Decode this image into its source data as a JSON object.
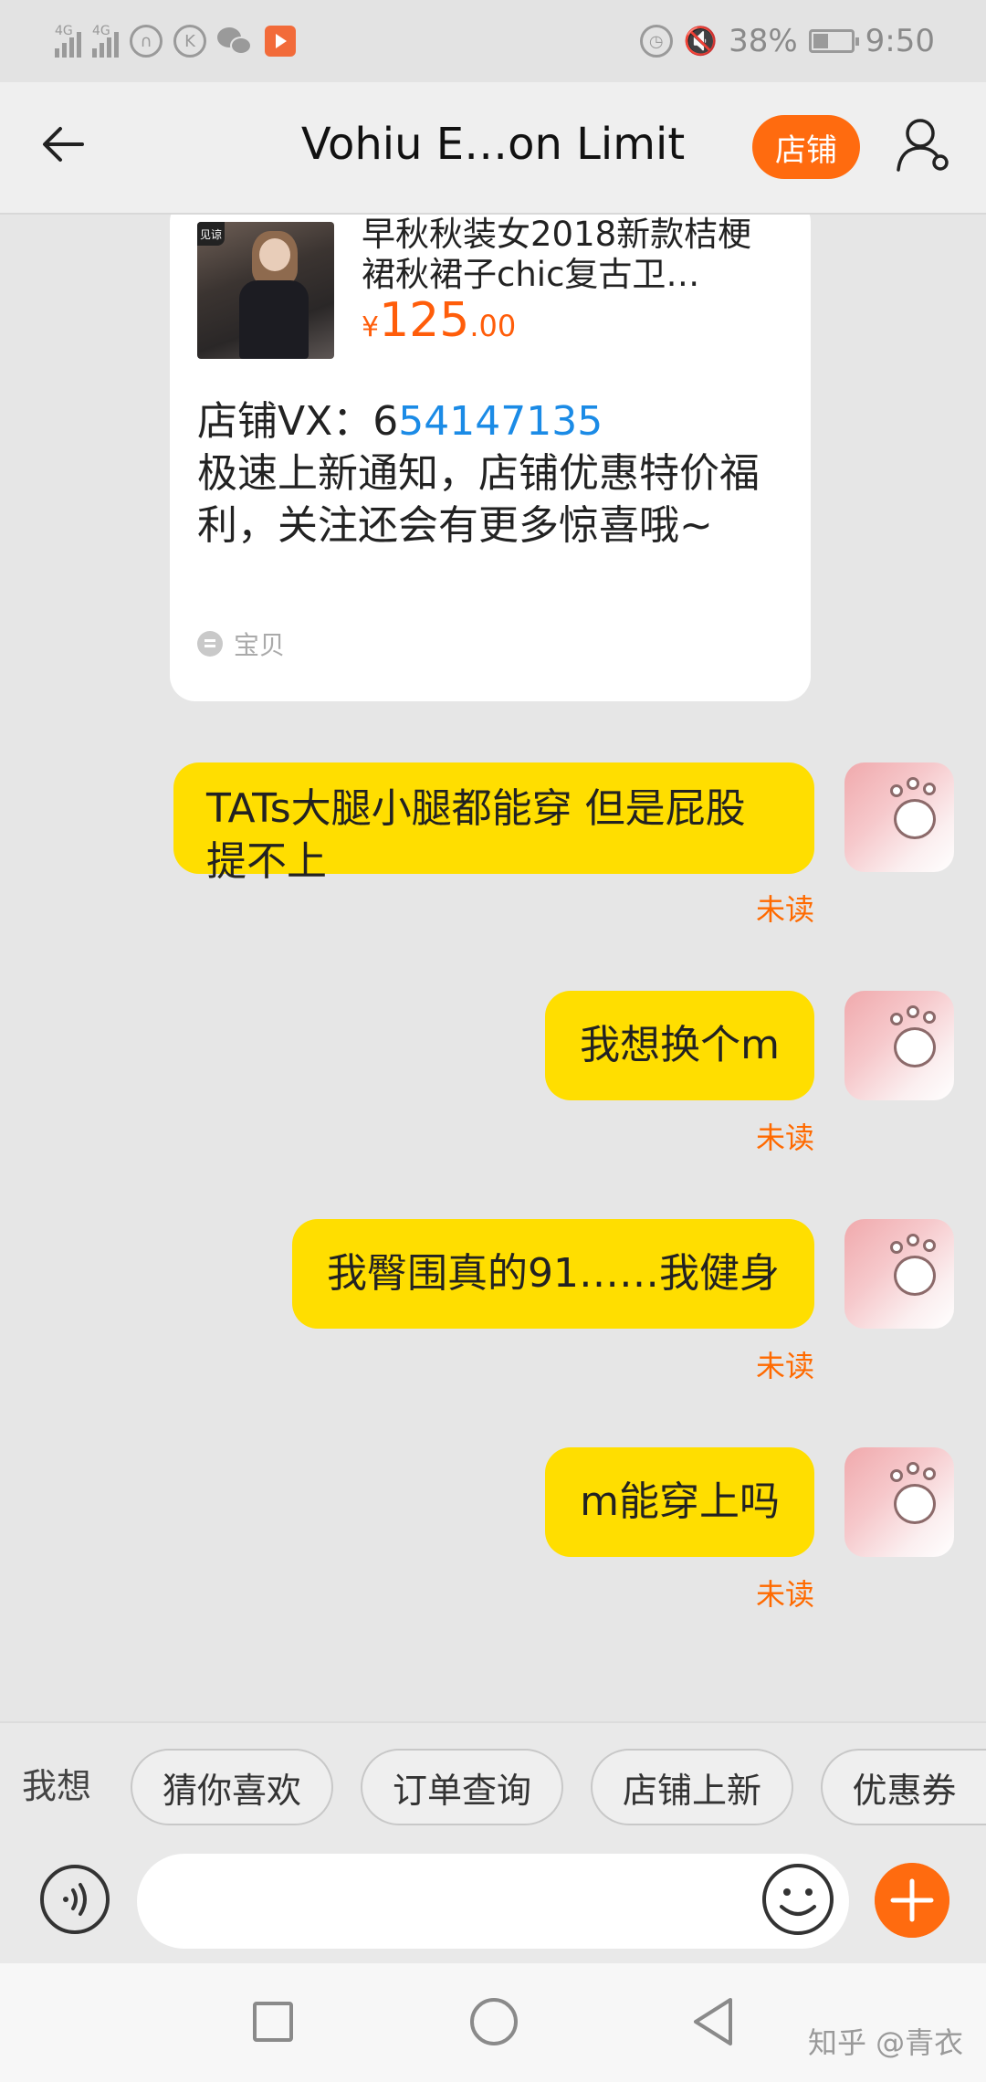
{
  "status_bar": {
    "network_1": "4G",
    "network_2": "4G",
    "battery": "38%",
    "time": "9:50",
    "icons": [
      "signal-icon",
      "headphone-icon",
      "k-icon",
      "wechat-icon",
      "video-app-icon",
      "alarm-icon",
      "mute-icon",
      "battery-icon"
    ]
  },
  "header": {
    "title": "Vohiu E…on Limit",
    "shop_label": "店铺"
  },
  "product_card": {
    "title": "早秋秋装女2018新款桔梗裙秋裙子chic复古卫…",
    "price_currency": "¥",
    "price_int": "125",
    "price_dec": ".00",
    "text_prefix": "店铺VX：6",
    "text_link": "54147135",
    "text_body": "极速上新通知，店铺优惠特价福利，关注还会有更多惊喜哦~",
    "footer_label": "宝贝"
  },
  "messages": [
    {
      "text": "TATs大腿小腿都能穿 但是屁股提不上",
      "status": "未读"
    },
    {
      "text": "我想换个m",
      "status": "未读"
    },
    {
      "text": "我臀围真的91……我健身",
      "status": "未读"
    },
    {
      "text": "m能穿上吗",
      "status": "未读"
    }
  ],
  "quick_replies": {
    "label": "我想",
    "chips": [
      "猜你喜欢",
      "订单查询",
      "店铺上新",
      "优惠券"
    ]
  },
  "input": {
    "placeholder": "",
    "value": ""
  },
  "watermark": "知乎 @青衣",
  "colors": {
    "accent": "#ff6b0f",
    "bubble": "#ffde00",
    "link": "#1b8be6",
    "unread": "#ff6a00"
  }
}
